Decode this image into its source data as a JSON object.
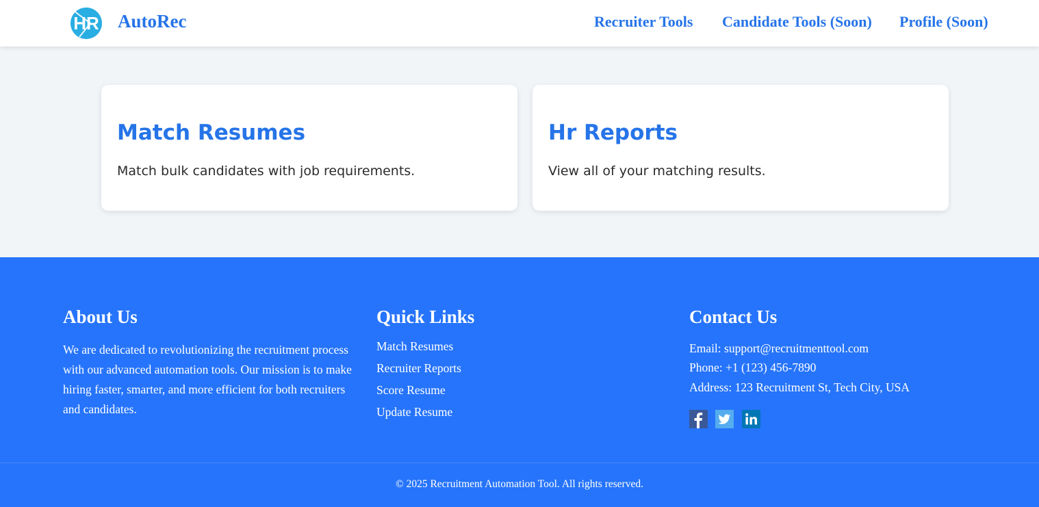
{
  "header": {
    "logo_text": "HR",
    "brand": "AutoRec",
    "nav": [
      {
        "label": "Recruiter Tools"
      },
      {
        "label": "Candidate Tools (Soon)"
      },
      {
        "label": "Profile (Soon)"
      }
    ]
  },
  "cards": [
    {
      "title": "Match Resumes",
      "description": "Match bulk candidates with job requirements."
    },
    {
      "title": "Hr Reports",
      "description": "View all of your matching results."
    }
  ],
  "footer": {
    "about": {
      "heading": "About Us",
      "text": "We are dedicated to revolutionizing the recruitment process with our advanced automation tools. Our mission is to make hiring faster, smarter, and more efficient for both recruiters and candidates."
    },
    "quick_links": {
      "heading": "Quick Links",
      "links": [
        "Match Resumes",
        "Recruiter Reports",
        "Score Resume",
        "Update Resume"
      ]
    },
    "contact": {
      "heading": "Contact Us",
      "email": "Email: support@recruitmenttool.com",
      "phone": "Phone: +1 (123) 456-7890",
      "address": "Address: 123 Recruitment St, Tech City, USA",
      "social": [
        {
          "icon": "facebook-icon",
          "color": "#3b5998"
        },
        {
          "icon": "twitter-icon",
          "color": "#55acee"
        },
        {
          "icon": "linkedin-icon",
          "color": "#0077b5"
        }
      ]
    },
    "copyright": "© 2025 Recruitment Automation Tool. All rights reserved."
  },
  "colors": {
    "accent": "#2674e8",
    "footer_bg": "#2674fb",
    "page_bg": "#f1f5f8",
    "logo": "#29aee3"
  }
}
